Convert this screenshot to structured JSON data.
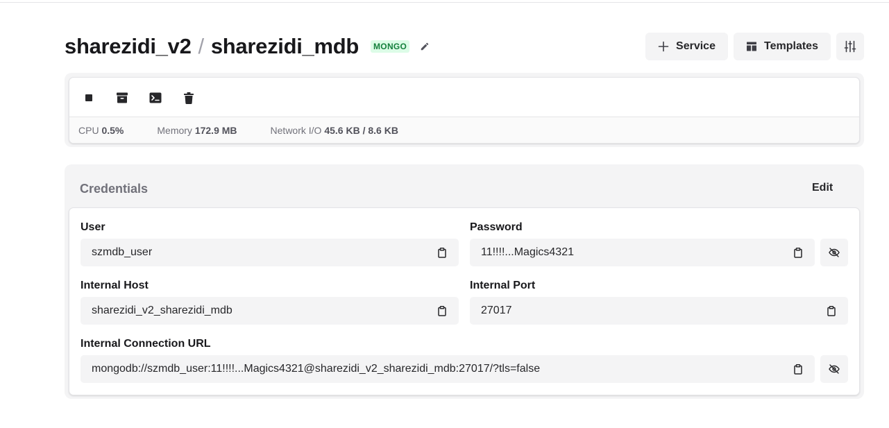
{
  "header": {
    "project": "sharezidi_v2",
    "separator": "/",
    "service": "sharezidi_mdb",
    "badge": "MONGO",
    "buttons": {
      "service_label": "Service",
      "templates_label": "Templates"
    }
  },
  "container": {
    "actions": [
      "stop-icon",
      "archive-icon",
      "terminal-icon",
      "trash-icon"
    ],
    "stats": {
      "cpu_label": "CPU",
      "cpu_value": "0.5%",
      "memory_label": "Memory",
      "memory_value": "172.9 MB",
      "network_label": "Network I/O",
      "network_value": "45.6 KB / 8.6 KB"
    }
  },
  "credentials": {
    "title": "Credentials",
    "edit_label": "Edit",
    "user": {
      "label": "User",
      "value": "szmdb_user"
    },
    "password": {
      "label": "Password",
      "value": "11!!!!...Magics4321"
    },
    "internal_host": {
      "label": "Internal Host",
      "value": "sharezidi_v2_sharezidi_mdb"
    },
    "internal_port": {
      "label": "Internal Port",
      "value": "27017"
    },
    "connection_url": {
      "label": "Internal Connection URL",
      "value": "mongodb://szmdb_user:11!!!!...Magics4321@sharezidi_v2_sharezidi_mdb:27017/?tls=false"
    }
  },
  "colors": {
    "accent_badge_text": "#15803d",
    "accent_badge_bg": "#dcfce7",
    "panel_bg": "#f4f4f5",
    "text_primary": "#18181b",
    "text_muted": "#71717a"
  }
}
